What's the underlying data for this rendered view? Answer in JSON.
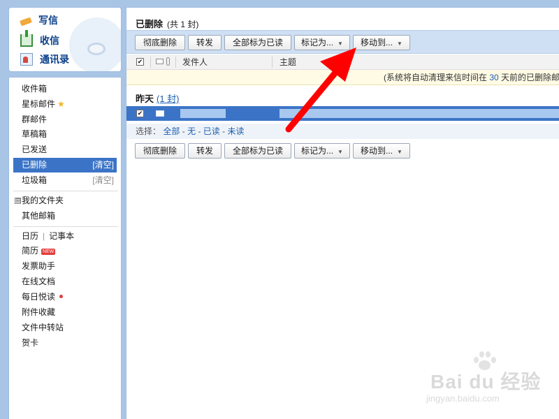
{
  "quick_links": [
    {
      "label": "写信",
      "icon": "pencil-icon"
    },
    {
      "label": "收信",
      "icon": "inbox-download-icon"
    },
    {
      "label": "通讯录",
      "icon": "contacts-icon"
    }
  ],
  "sidebar": {
    "folders": [
      {
        "label": "收件箱"
      },
      {
        "label": "星标邮件",
        "icon": "star-icon"
      },
      {
        "label": "群邮件"
      },
      {
        "label": "草稿箱"
      },
      {
        "label": "已发送"
      },
      {
        "label": "已删除",
        "action": "[清空]",
        "active": true
      },
      {
        "label": "垃圾箱",
        "action": "[清空]"
      }
    ],
    "my_folders": "我的文件夹",
    "other_mailbox": "其他邮箱",
    "apps": {
      "calendar": "日历",
      "separator": "|",
      "notebook": "记事本",
      "resume": "简历",
      "resume_badge": "NEW",
      "invoice": "发票助手",
      "docs": "在线文档",
      "daily_read": "每日悦读",
      "attachments": "附件收藏",
      "transfer": "文件中转站",
      "cards": "贺卡"
    },
    "expand_icon": "⊞"
  },
  "main": {
    "title": "已删除",
    "count_text": "(共 1 封)",
    "toolbar": {
      "delete_forever": "彻底删除",
      "forward": "转发",
      "mark_all_read": "全部标为已读",
      "mark_as": "标记为...",
      "move_to": "移动到...",
      "caret": "▼"
    },
    "columns": {
      "sender": "发件人",
      "subject": "主题"
    },
    "notice": {
      "prefix": "(系统将自动清理来信时间在",
      "days": "30",
      "suffix": "天前的已删除邮"
    },
    "group": {
      "title": "昨天",
      "count": "(1 封)"
    },
    "selection": {
      "label": "选择：",
      "all": "全部",
      "none": "无",
      "read": "已读",
      "unread": "未读",
      "dash": "-"
    }
  },
  "annotation": {
    "arrow_color": "#ff0000"
  },
  "watermark": {
    "brand": "Bai du 经验",
    "url": "jingyan.baidu.com"
  },
  "colors": {
    "accent_blue": "#3b74c7",
    "link_blue": "#1c5fae",
    "toolbar_bg": "#cfe0f4",
    "notice_bg": "#fffbe5"
  }
}
